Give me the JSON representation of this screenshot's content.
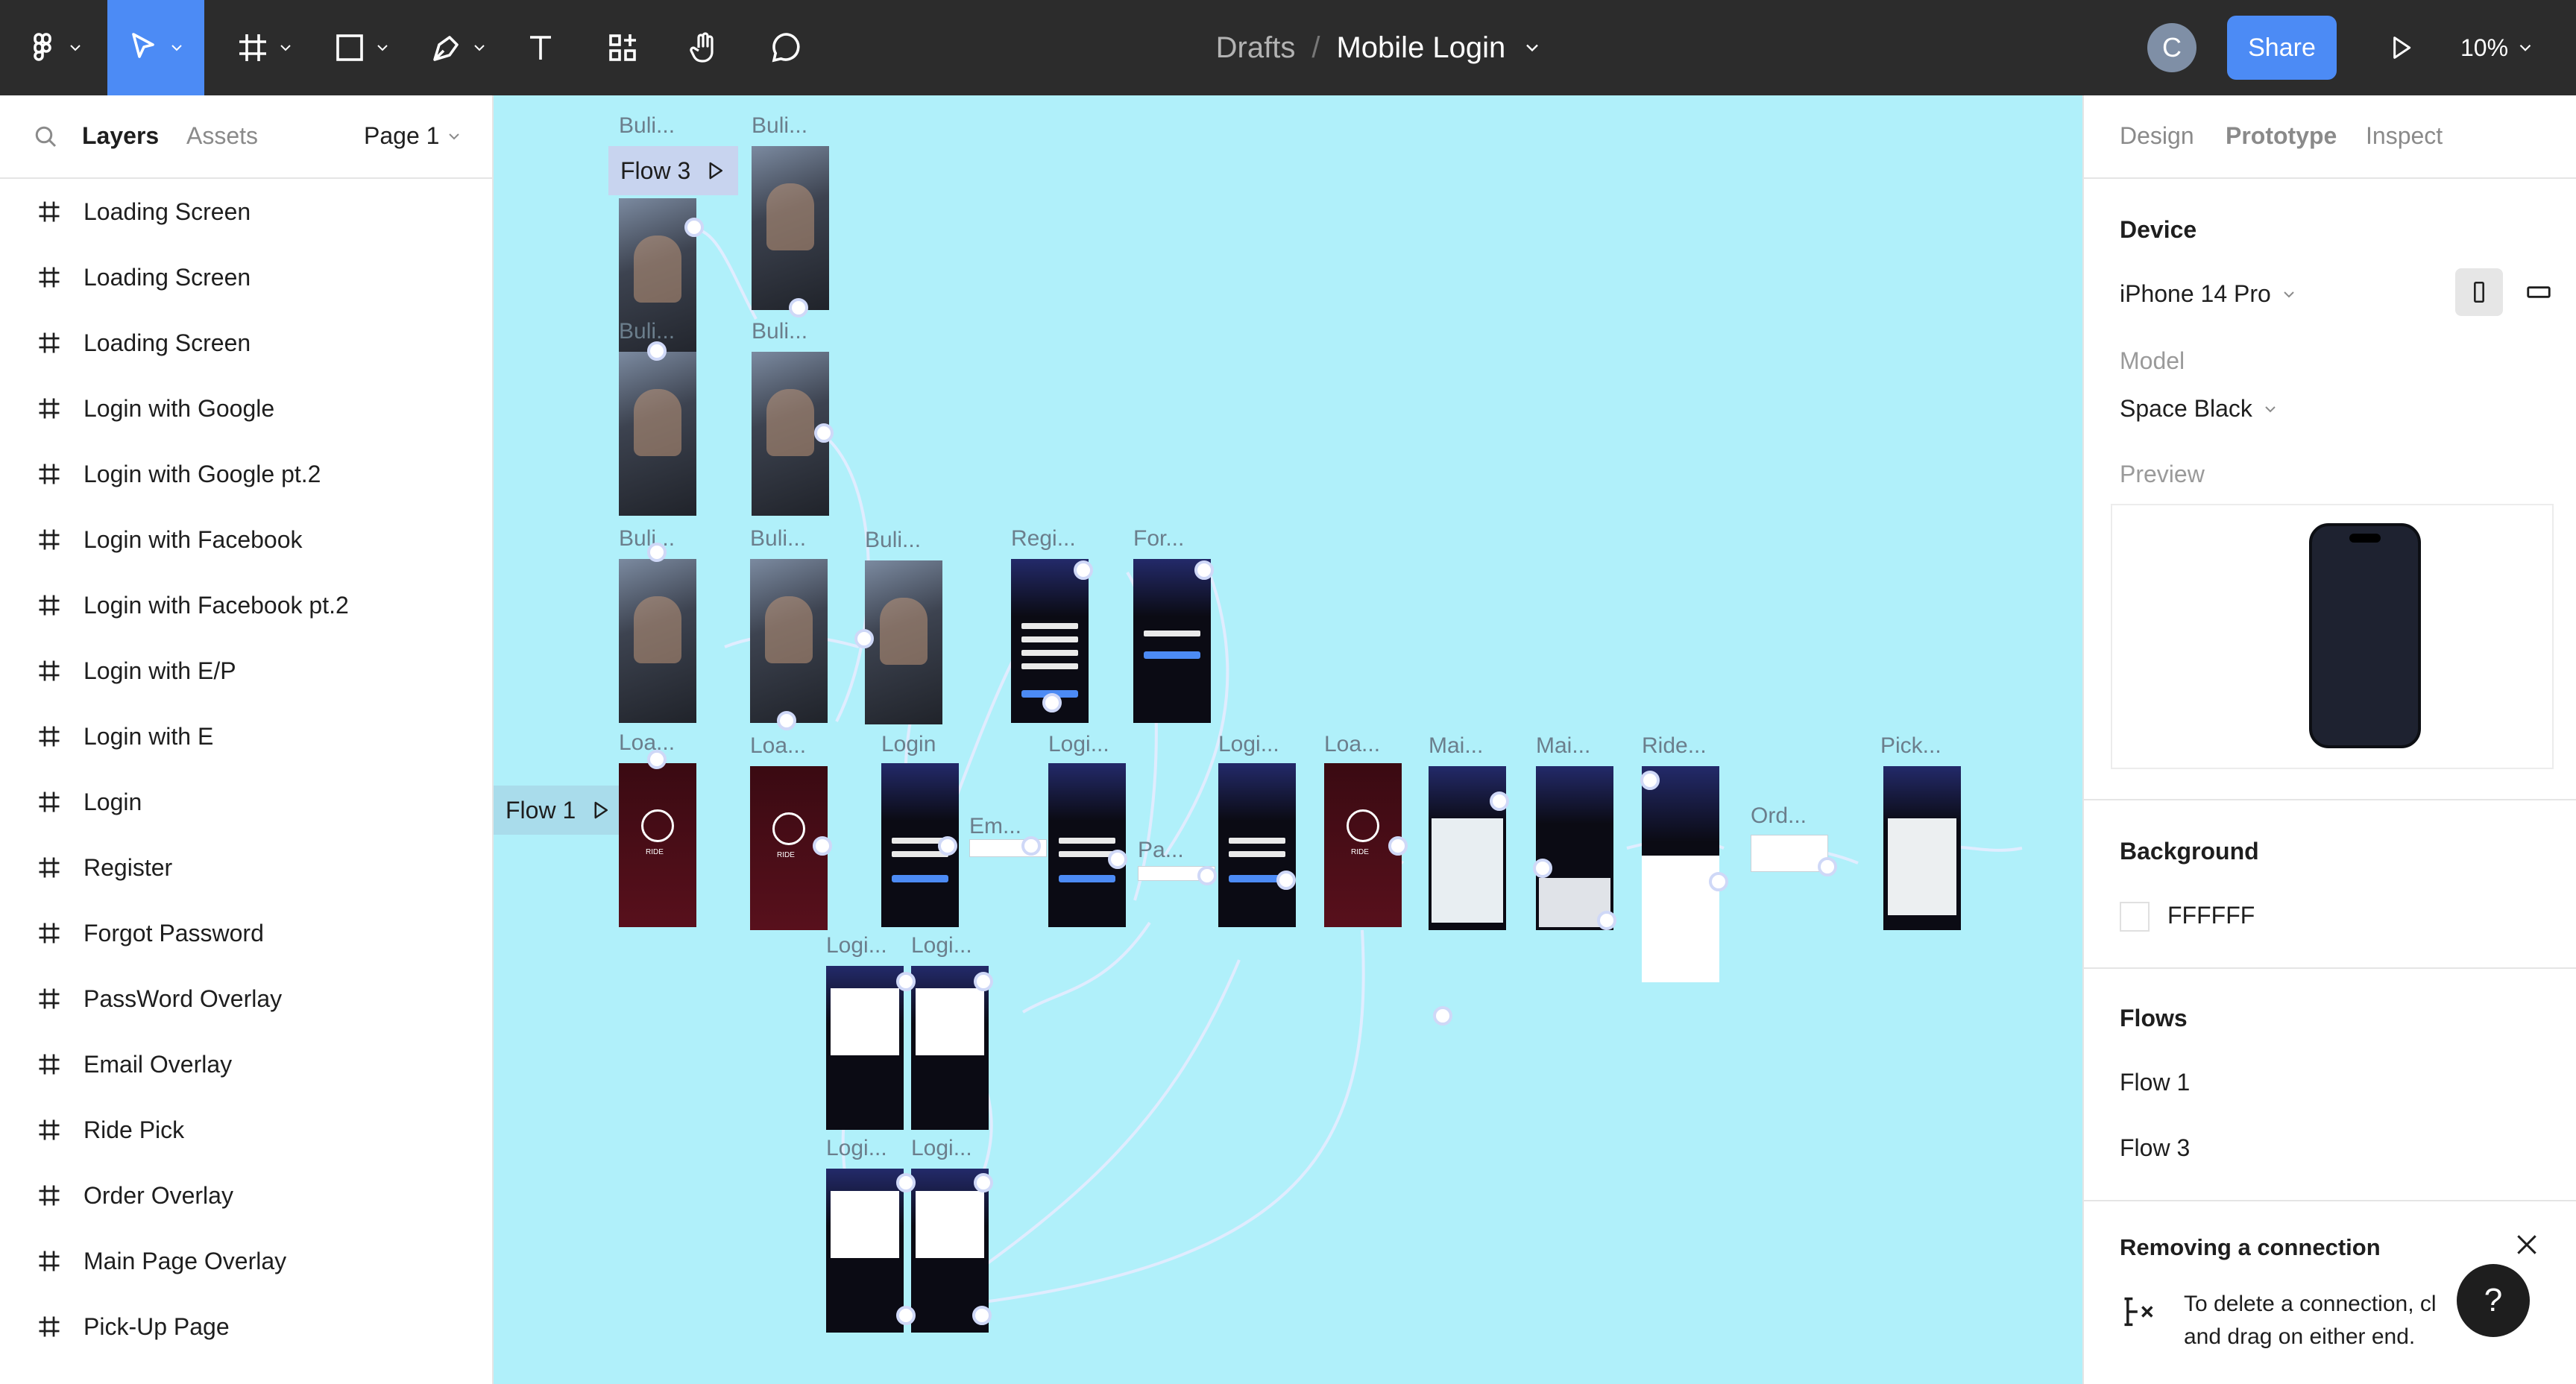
{
  "toolbar": {
    "breadcrumb_drafts": "Drafts",
    "breadcrumb_sep": "/",
    "file_name": "Mobile Login",
    "avatar_initial": "C",
    "share_label": "Share",
    "zoom": "10%",
    "active_tool": "move"
  },
  "left_panel": {
    "tabs": {
      "layers": "Layers",
      "assets": "Assets"
    },
    "page": "Page 1",
    "layers": [
      "Loading Screen",
      "Loading Screen",
      "Loading Screen",
      "Login with Google",
      "Login with Google pt.2",
      "Login with Facebook",
      "Login with Facebook pt.2",
      "Login with E/P",
      "Login with E",
      "Login",
      "Register",
      "Forgot Password",
      "PassWord Overlay",
      "Email Overlay",
      "Ride Pick",
      "Order Overlay",
      "Main Page Overlay",
      "Pick-Up Page"
    ]
  },
  "canvas": {
    "background": "#b0f0fa",
    "flows": [
      "Flow 3",
      "Flow 1"
    ],
    "frame_labels": [
      "Buli...",
      "Buli...",
      "Buli...",
      "Buli...",
      "Buli...",
      "Buli...",
      "Buli...",
      "Regi...",
      "For...",
      "Loa...",
      "Loa...",
      "Login",
      "Logi...",
      "Logi...",
      "Loa...",
      "Mai...",
      "Mai...",
      "Ride...",
      "Pick...",
      "Em...",
      "Pa...",
      "Ord...",
      "Logi...",
      "Logi...",
      "Logi...",
      "Logi..."
    ],
    "frame_text": {
      "ride": "RIDE"
    }
  },
  "right_panel": {
    "tabs": {
      "design": "Design",
      "prototype": "Prototype",
      "inspect": "Inspect"
    },
    "device_title": "Device",
    "device": "iPhone 14 Pro",
    "model_label": "Model",
    "model": "Space Black",
    "preview_label": "Preview",
    "background_title": "Background",
    "background_hex": "FFFFFF",
    "flows_title": "Flows",
    "flows": [
      "Flow 1",
      "Flow 3"
    ],
    "notice_title": "Removing a connection",
    "notice_text": "To delete a connection, cl and drag on either end.",
    "help": "?"
  },
  "colors": {
    "toolbar_bg": "#2c2c2c",
    "accent": "#4c8bf5",
    "canvas_bg": "#b0f0fa",
    "flow_chip": "#c8d4ef"
  }
}
